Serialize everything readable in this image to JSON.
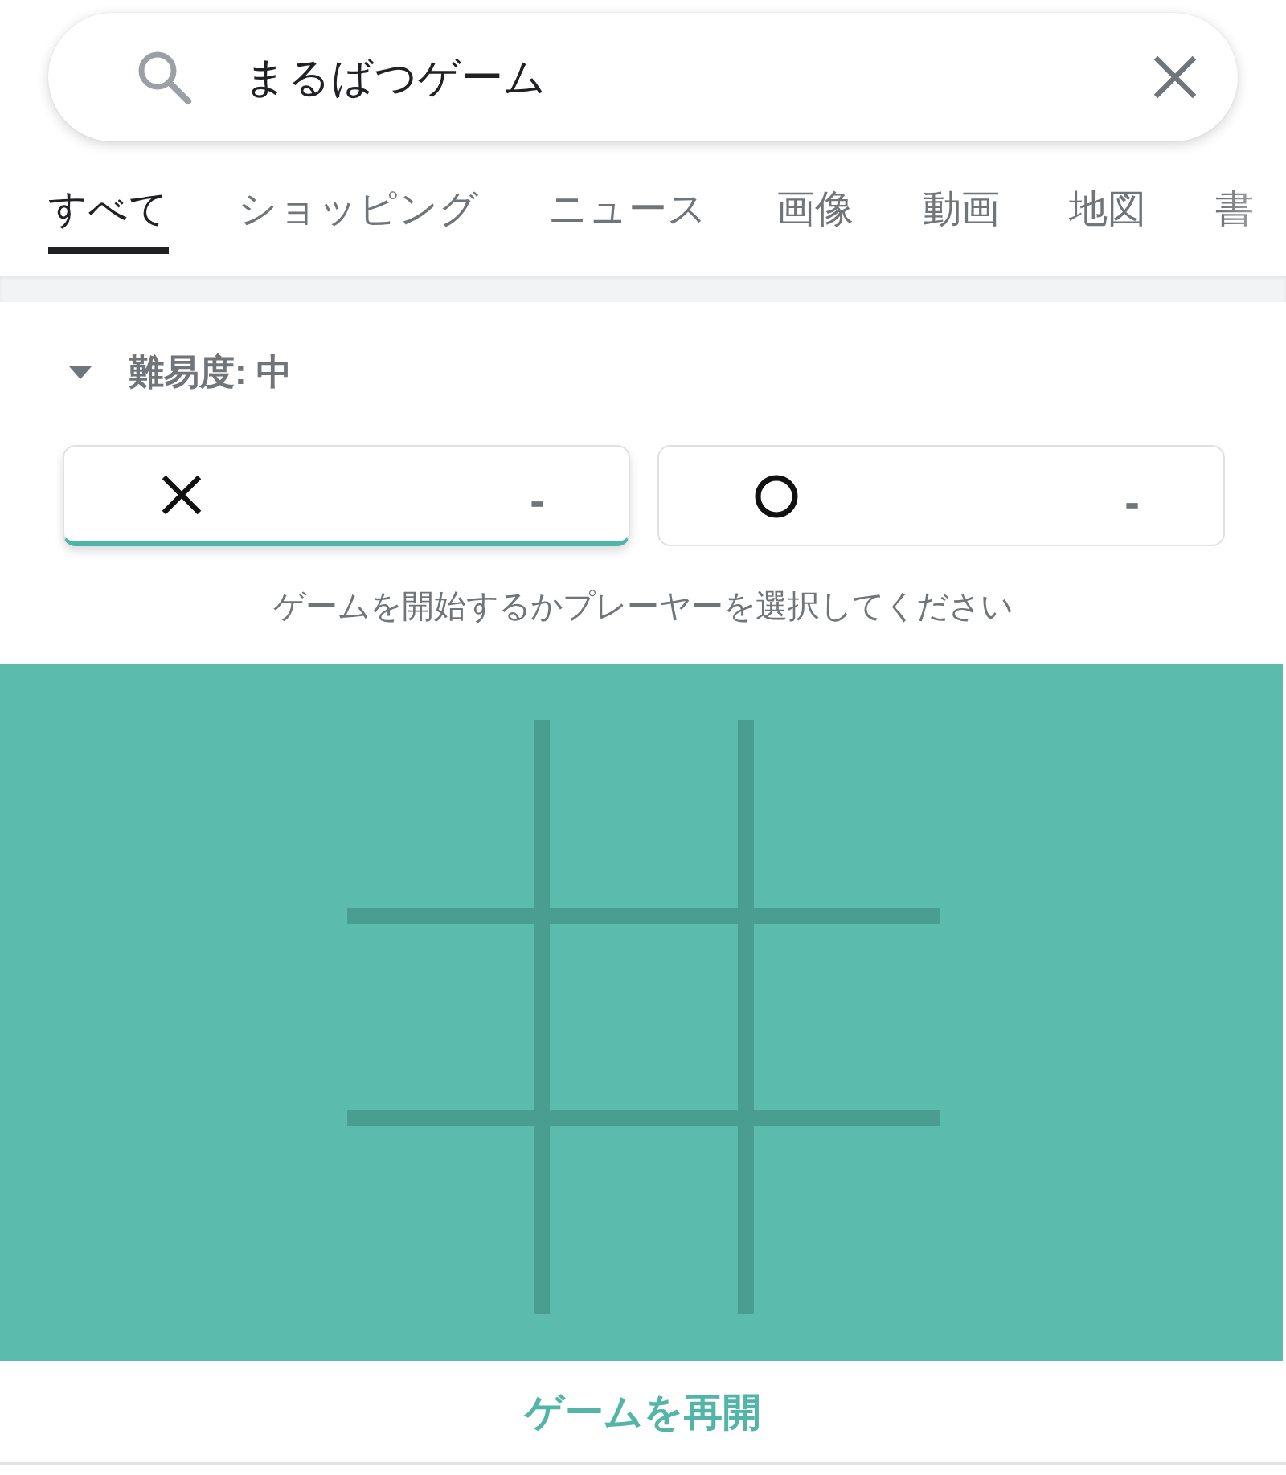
{
  "search": {
    "value": "まるばつゲーム"
  },
  "tabs": [
    {
      "label": "すべて",
      "selected": true
    },
    {
      "label": "ショッピング",
      "selected": false
    },
    {
      "label": "ニュース",
      "selected": false
    },
    {
      "label": "画像",
      "selected": false
    },
    {
      "label": "動画",
      "selected": false
    },
    {
      "label": "地図",
      "selected": false
    },
    {
      "label": "書",
      "selected": false
    }
  ],
  "game": {
    "difficulty": {
      "label": "難易度: 中",
      "expanded": true
    },
    "players": [
      {
        "kind": "x",
        "score": "-",
        "selected": true
      },
      {
        "kind": "o",
        "score": "-",
        "selected": false
      }
    ],
    "hint": "ゲームを開始するかプレーヤーを選択してください",
    "restart": "ゲームを再開"
  }
}
